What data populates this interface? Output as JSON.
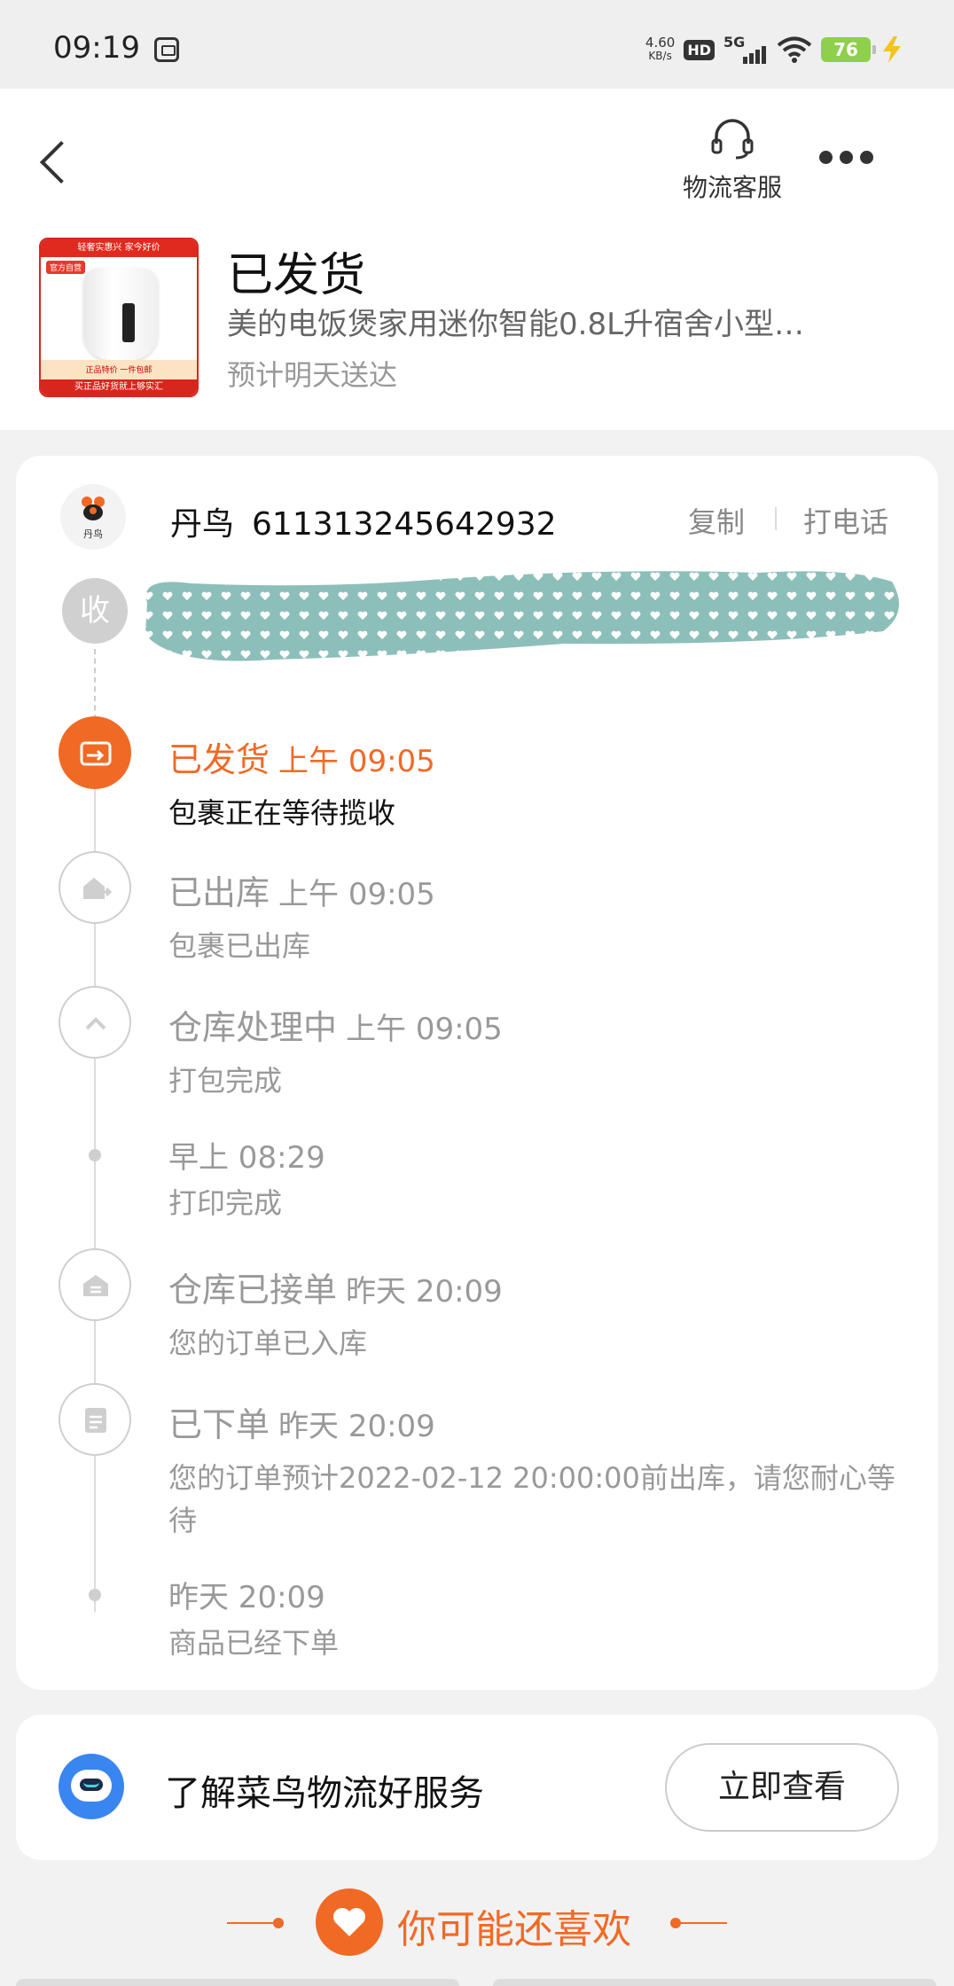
{
  "status_bar": {
    "time": "09:19",
    "speed_value": "4.60",
    "speed_unit": "KB/s",
    "hd": "HD",
    "network": "5G",
    "battery": "76"
  },
  "header": {
    "service_label": "物流客服",
    "status_title": "已发货",
    "product_name": "美的电饭煲家用迷你智能0.8L升宿舍小型…",
    "eta": "预计明天送达"
  },
  "product_image": {
    "top_banner": "轻奢实惠兴 家今好价",
    "tag": "官方自营",
    "promo": "正品特价 一件包邮",
    "bottom_banner": "买正品好货就上够实汇"
  },
  "courier": {
    "name": "丹鸟",
    "logo_label": "丹鸟",
    "tracking_number": "611313245642932",
    "copy_label": "复制",
    "call_label": "打电话",
    "receive_label": "收"
  },
  "timeline": [
    {
      "status": "已发货",
      "time": "上午 09:05",
      "desc": "包裹正在等待揽收"
    },
    {
      "status": "已出库",
      "time": "上午 09:05",
      "desc": "包裹已出库"
    },
    {
      "status": "仓库处理中",
      "time": "上午 09:05",
      "desc": "打包完成"
    },
    {
      "status": "",
      "time": "早上 08:29",
      "desc": "打印完成"
    },
    {
      "status": "仓库已接单",
      "time": "昨天 20:09",
      "desc": "您的订单已入库"
    },
    {
      "status": "已下单",
      "time": "昨天 20:09",
      "desc": "您的订单预计2022-02-12 20:00:00前出库，请您耐心等待"
    },
    {
      "status": "",
      "time": "昨天 20:09",
      "desc": "商品已经下单"
    }
  ],
  "service_banner": {
    "text": "了解菜鸟物流好服务",
    "button": "立即查看"
  },
  "recommend": {
    "label": "你可能还喜欢"
  },
  "colors": {
    "accent": "#f06a25",
    "grey_text": "#999999",
    "redaction": "#8dbfba"
  }
}
